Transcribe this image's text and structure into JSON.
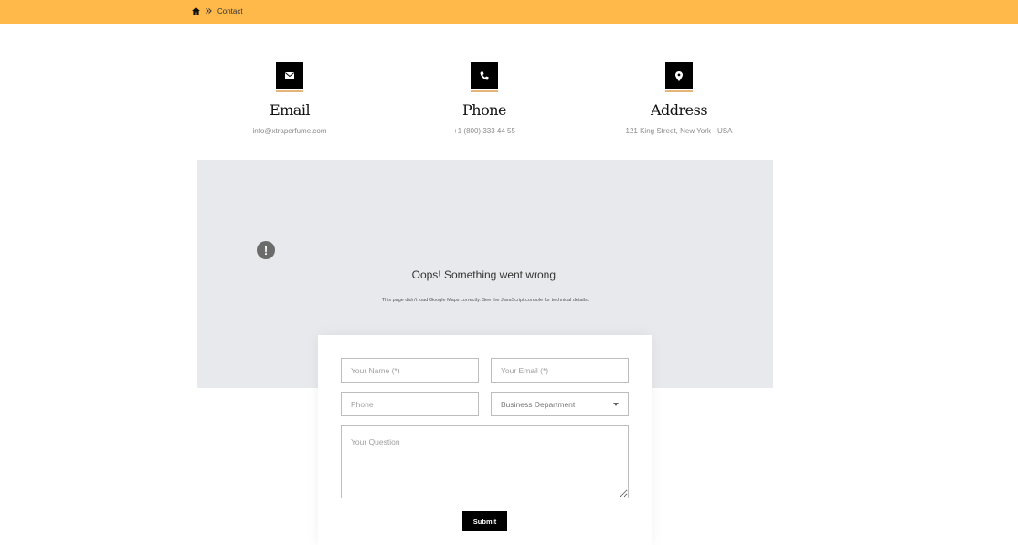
{
  "breadcrumb": {
    "home_icon": "home-icon",
    "separator_icon": "double-chevron-right-icon",
    "current": "Contact"
  },
  "colors": {
    "topbar": "#ffb84a",
    "icon_bg": "#000000",
    "icon_underline": "#e4b47a",
    "map_bg": "#e8e9ec"
  },
  "contact": [
    {
      "icon": "envelope-icon",
      "title": "Email",
      "value": "info@xtraperfume.com"
    },
    {
      "icon": "phone-icon",
      "title": "Phone",
      "value": "+1 (800) 333 44 55"
    },
    {
      "icon": "map-pin-icon",
      "title": "Address",
      "value": "121 King Street, New York - USA"
    }
  ],
  "map": {
    "warning_icon": "exclamation-icon",
    "title": "Oops! Something went wrong.",
    "message": "This page didn't load Google Maps correctly. See the JavaScript console for technical details."
  },
  "form": {
    "name_placeholder": "Your Name (*)",
    "email_placeholder": "Your Email (*)",
    "phone_placeholder": "Phone",
    "department_selected": "Business Department",
    "question_placeholder": "Your Question",
    "submit_label": "Submit"
  }
}
